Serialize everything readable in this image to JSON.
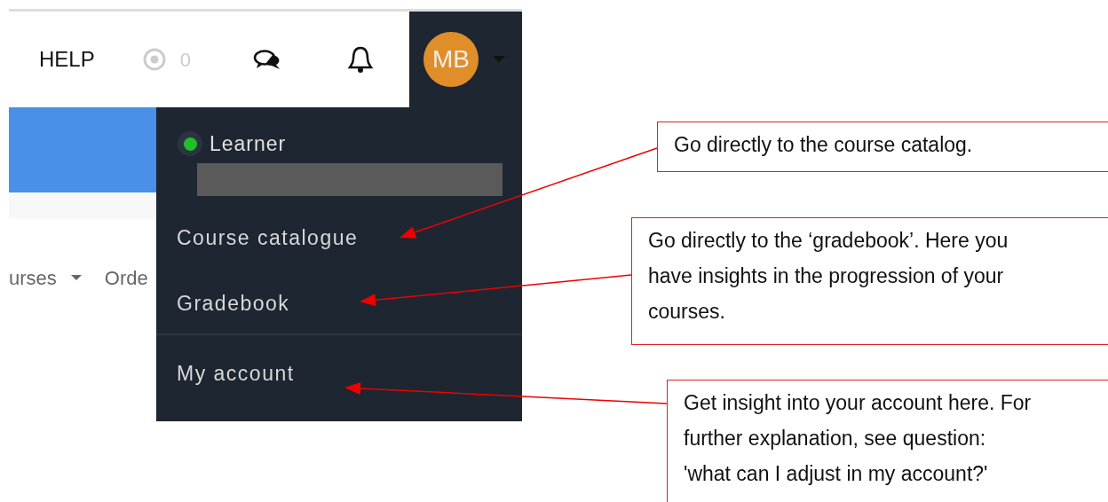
{
  "header": {
    "help": "HELP",
    "points_count": "0",
    "avatar_initials": "MB"
  },
  "subnav": [
    {
      "label": "urses",
      "caret": true
    },
    {
      "label": "Orde",
      "caret": false
    }
  ],
  "user_menu": {
    "role": "Learner",
    "items": [
      {
        "label": "Course catalogue",
        "divider_before": false
      },
      {
        "label": "Gradebook",
        "divider_before": false
      },
      {
        "label": "My account",
        "divider_before": true
      }
    ]
  },
  "annotations": [
    {
      "text": "Go directly to the course catalog."
    },
    {
      "text": "Go directly to the ‘gradebook’. Here you have insights in the progression of your courses."
    },
    {
      "text": "Get insight into your account here. For further explanation, see question: 'what can I adjust in my account?'"
    }
  ]
}
